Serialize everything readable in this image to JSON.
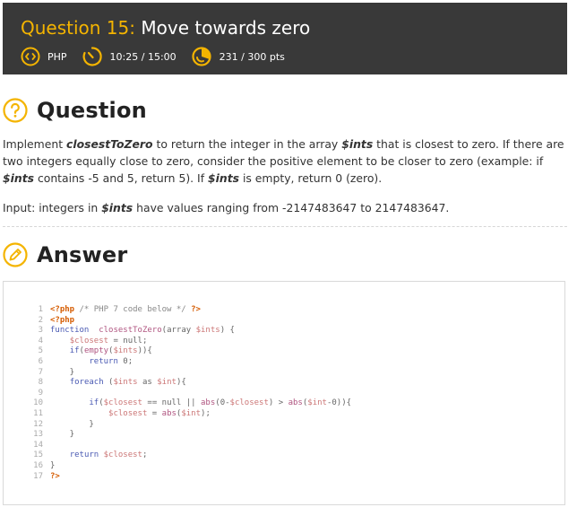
{
  "header": {
    "title_prefix": "Question 15:",
    "title": "Move towards zero",
    "language": "PHP",
    "time": "10:25 / 15:00",
    "points": "231 / 300 pts",
    "accent": "#f4b400",
    "bg": "#393939"
  },
  "question": {
    "heading": "Question",
    "p1_a": "Implement ",
    "p1_fn": "closestToZero",
    "p1_b": " to return the integer in the array ",
    "p1_var": "$ints",
    "p1_c": " that is closest to zero. If there are two integers equally close to zero, consider the positive element to be closer to zero (example: if ",
    "p1_var2": "$ints",
    "p1_d": " contains -5 and 5, return 5). If ",
    "p1_var3": "$ints",
    "p1_e": " is empty, return 0 (zero).",
    "p2_a": "Input: integers in ",
    "p2_var": "$ints",
    "p2_b": " have values ranging from -2147483647 to 2147483647."
  },
  "answer": {
    "heading": "Answer"
  },
  "code": {
    "lines": [
      {
        "n": "1",
        "parts": [
          [
            "tag",
            "<?php"
          ],
          [
            "cm",
            " /* PHP 7 code below */ "
          ],
          [
            "tag",
            "?>"
          ]
        ]
      },
      {
        "n": "2",
        "parts": [
          [
            "tag",
            "<?php"
          ]
        ]
      },
      {
        "n": "3",
        "parts": [
          [
            "kw",
            "function"
          ],
          [
            "",
            "  "
          ],
          [
            "fn",
            "closestToZero"
          ],
          [
            "",
            "(array "
          ],
          [
            "var",
            "$ints"
          ],
          [
            "",
            ") {"
          ]
        ]
      },
      {
        "n": "4",
        "parts": [
          [
            "",
            "    "
          ],
          [
            "var",
            "$closest"
          ],
          [
            "",
            " = null;"
          ]
        ]
      },
      {
        "n": "5",
        "parts": [
          [
            "",
            "    "
          ],
          [
            "kw",
            "if"
          ],
          [
            "",
            "("
          ],
          [
            "fn",
            "empty"
          ],
          [
            "",
            "("
          ],
          [
            "var",
            "$ints"
          ],
          [
            "",
            ")){"
          ]
        ]
      },
      {
        "n": "6",
        "parts": [
          [
            "",
            "        "
          ],
          [
            "kw",
            "return"
          ],
          [
            "",
            " 0;"
          ]
        ]
      },
      {
        "n": "7",
        "parts": [
          [
            "",
            "    }"
          ]
        ]
      },
      {
        "n": "8",
        "parts": [
          [
            "",
            "    "
          ],
          [
            "kw",
            "foreach"
          ],
          [
            "",
            " ("
          ],
          [
            "var",
            "$ints"
          ],
          [
            "",
            " as "
          ],
          [
            "var",
            "$int"
          ],
          [
            "",
            "){"
          ]
        ]
      },
      {
        "n": "9",
        "parts": [
          [
            "",
            ""
          ]
        ]
      },
      {
        "n": "10",
        "parts": [
          [
            "",
            "        "
          ],
          [
            "kw",
            "if"
          ],
          [
            "",
            "("
          ],
          [
            "var",
            "$closest"
          ],
          [
            "",
            " == null || "
          ],
          [
            "fn",
            "abs"
          ],
          [
            "",
            "(0-"
          ],
          [
            "var",
            "$closest"
          ],
          [
            "",
            ") > "
          ],
          [
            "fn",
            "abs"
          ],
          [
            "",
            "("
          ],
          [
            "var",
            "$int"
          ],
          [
            "",
            "-0)){"
          ]
        ]
      },
      {
        "n": "11",
        "parts": [
          [
            "",
            "            "
          ],
          [
            "var",
            "$closest"
          ],
          [
            "",
            " = "
          ],
          [
            "fn",
            "abs"
          ],
          [
            "",
            "("
          ],
          [
            "var",
            "$int"
          ],
          [
            "",
            ");"
          ]
        ]
      },
      {
        "n": "12",
        "parts": [
          [
            "",
            "        }"
          ]
        ]
      },
      {
        "n": "13",
        "parts": [
          [
            "",
            "    }"
          ]
        ]
      },
      {
        "n": "14",
        "parts": [
          [
            "",
            ""
          ]
        ]
      },
      {
        "n": "15",
        "parts": [
          [
            "",
            "    "
          ],
          [
            "kw",
            "return"
          ],
          [
            "",
            " "
          ],
          [
            "var",
            "$closest"
          ],
          [
            "",
            ";"
          ]
        ]
      },
      {
        "n": "16",
        "parts": [
          [
            "",
            "}"
          ]
        ]
      },
      {
        "n": "17",
        "parts": [
          [
            "tag",
            "?>"
          ]
        ]
      }
    ]
  }
}
